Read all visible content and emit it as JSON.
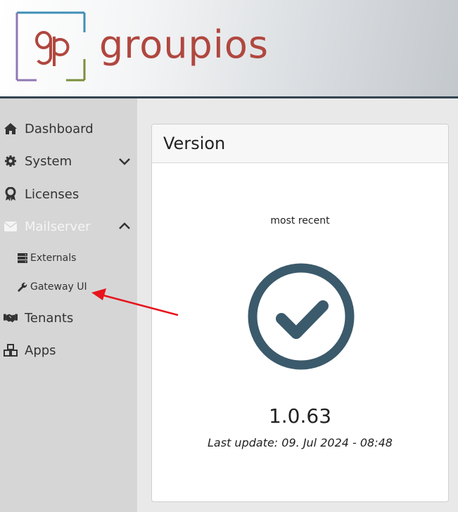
{
  "brand": {
    "name": "groupios",
    "mark_text": "gp",
    "colors": {
      "text": "#b0473f",
      "frame_top": "#3f8fb5",
      "frame_left": "#8f78b3",
      "frame_bottom": "#7a8f3a",
      "frame_right": "#d28a2a"
    }
  },
  "sidebar": {
    "items": [
      {
        "label": "Dashboard",
        "icon": "home-icon"
      },
      {
        "label": "System",
        "icon": "gear-icon",
        "expandable": "collapsed"
      },
      {
        "label": "Licenses",
        "icon": "award-icon"
      },
      {
        "label": "Mailserver",
        "icon": "envelope-icon",
        "expandable": "expanded",
        "active": true,
        "children": [
          {
            "label": "Externals",
            "icon": "server-icon"
          },
          {
            "label": "Gateway UI",
            "icon": "wrench-icon"
          }
        ]
      },
      {
        "label": "Tenants",
        "icon": "handshake-icon"
      },
      {
        "label": "Apps",
        "icon": "cubes-icon"
      }
    ]
  },
  "card": {
    "title": "Version",
    "status_label": "most recent",
    "status_icon": "check-circle-icon",
    "version": "1.0.63",
    "last_update": "Last update: 09. Jul 2024 - 08:48",
    "accent_color": "#3b5a6b"
  },
  "annotation": {
    "color": "#e8141c",
    "points_to": "Gateway UI"
  }
}
